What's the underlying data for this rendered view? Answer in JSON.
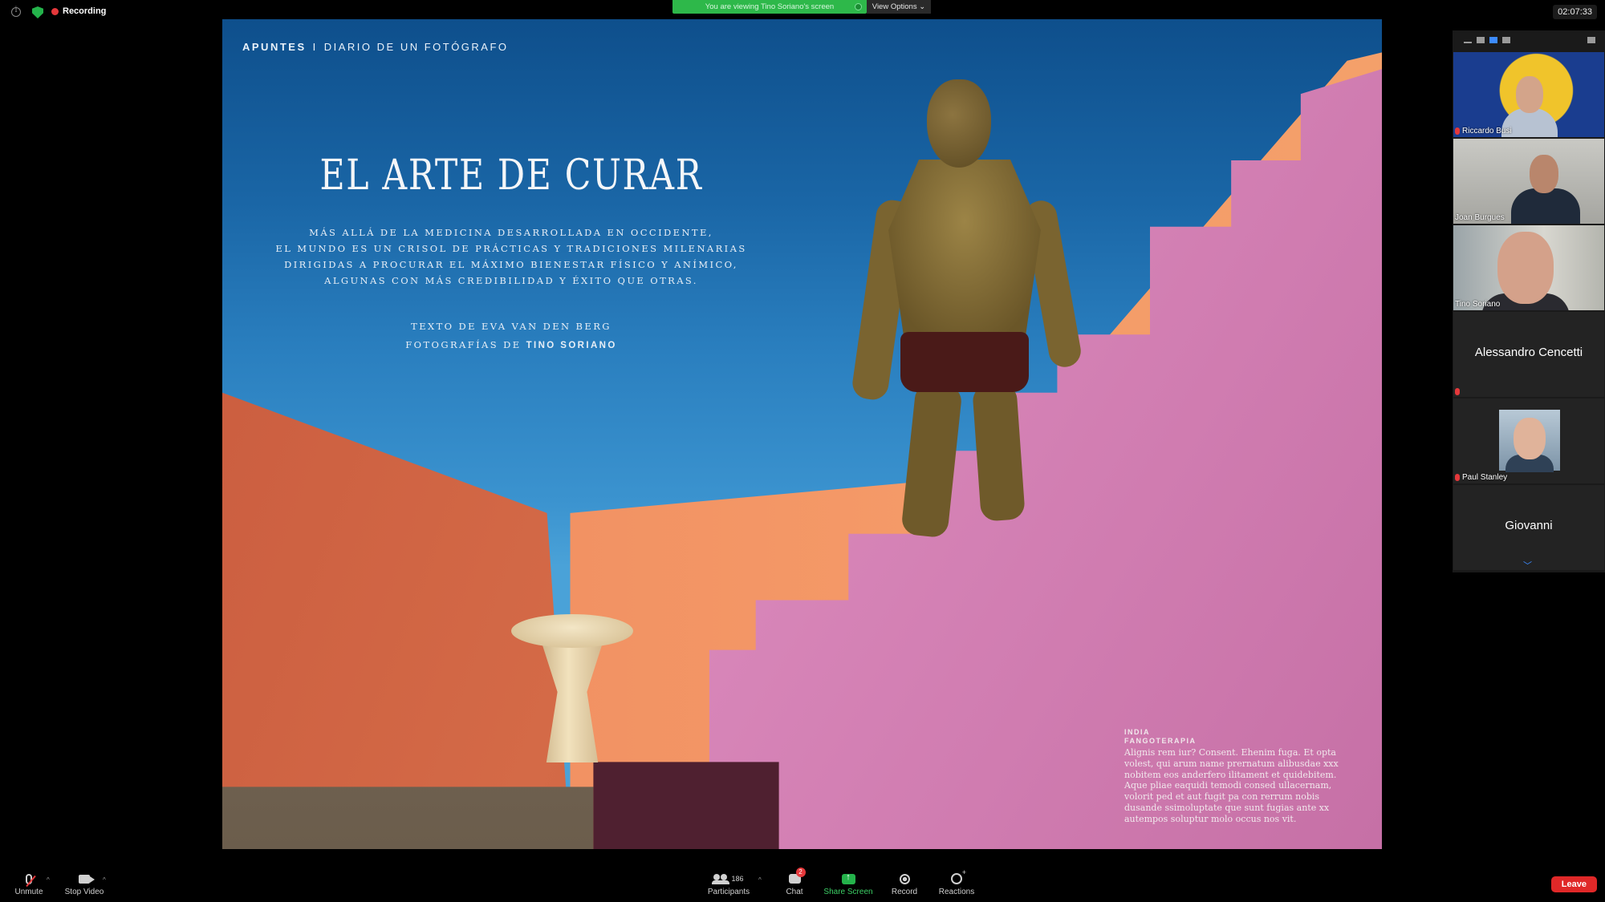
{
  "topbar": {
    "recording_label": "Recording",
    "viewing_banner": "You are viewing Tino Soriano's screen",
    "view_options_label": "View Options",
    "clock": "02:07:33"
  },
  "magazine": {
    "section": "APUNTES",
    "section_sep": "I",
    "section_sub": "DIARIO DE UN FOTÓGRAFO",
    "title": "EL ARTE DE CURAR",
    "intro_lines": [
      "MÁS ALLÁ DE LA MEDICINA DESARROLLADA EN OCCIDENTE,",
      "EL MUNDO ES UN CRISOL DE PRÁCTICAS Y TRADICIONES MILENARIAS",
      "DIRIGIDAS A PROCURAR EL MÁXIMO BIENESTAR FÍSICO Y ANÍMICO,",
      "ALGUNAS CON MÁS CREDIBILIDAD Y ÉXITO QUE OTRAS."
    ],
    "credit_text": "TEXTO DE EVA VAN DEN BERG",
    "credit_photo_prefix": "FOTOGRAFÍAS DE",
    "credit_photo_name": "TINO SORIANO",
    "caption_place": "INDIA",
    "caption_topic": "FANGOTERAPIA",
    "caption_body": "Alignis rem iur? Consent. Ehenim fuga. Et opta volest, qui arum name prernatum alibusdae  xxx nobitem eos anderfero ilitament et quidebitem. Aque pliae eaquidi temodi consed ullacernam, volorit ped et aut fugit pa con rerrum nobis dusande ssimoluptate que sunt fugias ante xx autempos soluptur molo occus nos vit."
  },
  "participants": [
    {
      "name": "Riccardo Busi",
      "muted": true
    },
    {
      "name": "Joan Burgues",
      "muted": false
    },
    {
      "name": "Tino Soriano",
      "muted": false,
      "active": true
    },
    {
      "name": "Alessandro Cencetti",
      "muted": true
    },
    {
      "name": "Paul Stanley",
      "muted": true
    },
    {
      "name": "Giovanni",
      "muted": false
    }
  ],
  "toolbar": {
    "unmute": "Unmute",
    "stop_video": "Stop Video",
    "participants": "Participants",
    "participants_count": "186",
    "chat": "Chat",
    "chat_badge": "2",
    "share_screen": "Share Screen",
    "record": "Record",
    "reactions": "Reactions",
    "leave": "Leave"
  },
  "colors": {
    "zoom_green": "#2eb84a",
    "leave_red": "#e02828",
    "active_speaker": "#e8d650"
  }
}
